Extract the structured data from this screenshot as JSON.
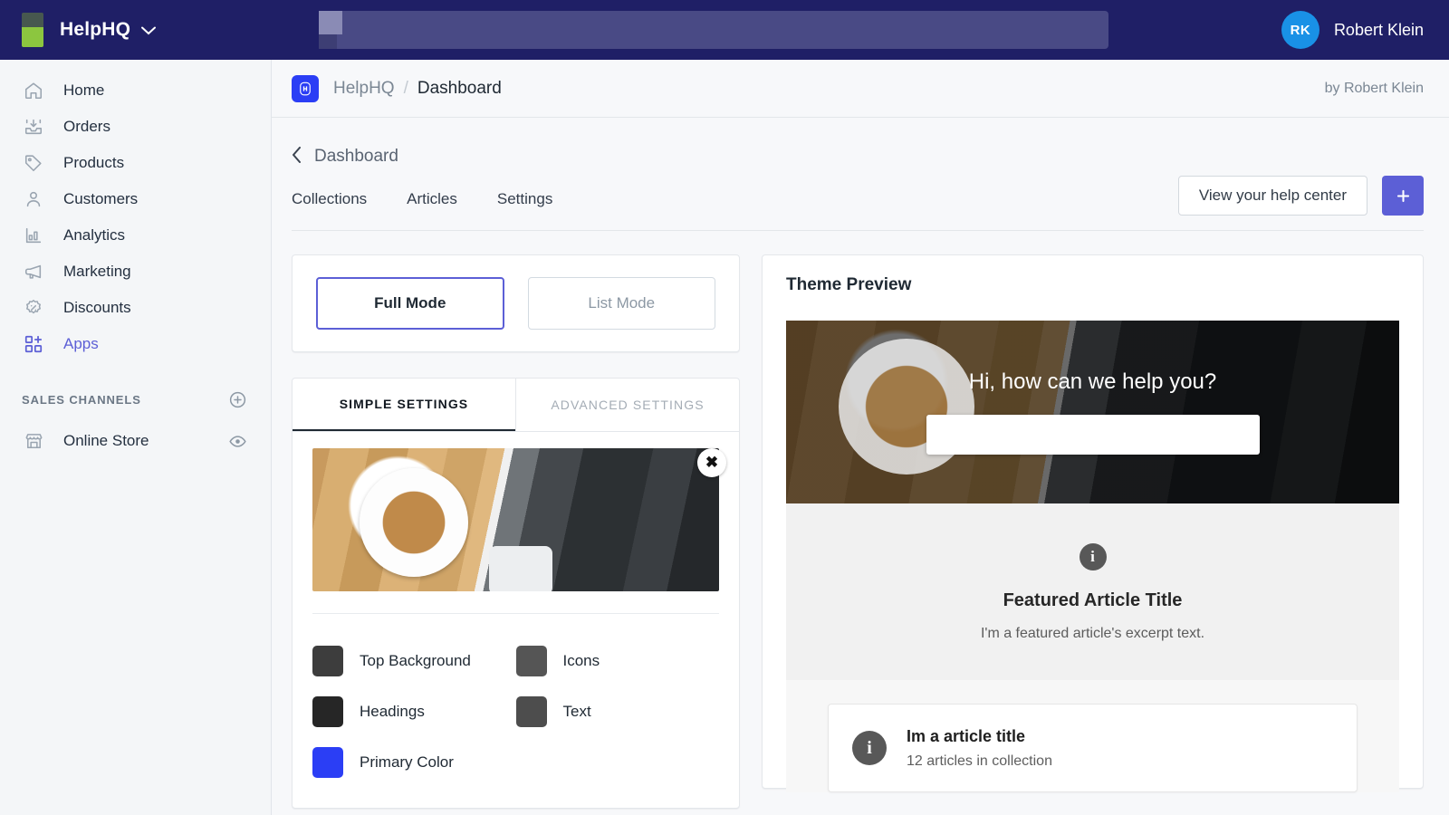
{
  "topbar": {
    "brand_name": "HelpHQ",
    "brand_caret": "⌄",
    "search_value": "",
    "search_placeholder": "",
    "user_initials": "RK",
    "user_name": "Robert Klein"
  },
  "sidebar": {
    "items": [
      {
        "label": "Home",
        "icon": "home-icon",
        "active": false
      },
      {
        "label": "Orders",
        "icon": "orders-icon",
        "active": false
      },
      {
        "label": "Products",
        "icon": "products-tag-icon",
        "active": false
      },
      {
        "label": "Customers",
        "icon": "customers-person-icon",
        "active": false
      },
      {
        "label": "Analytics",
        "icon": "analytics-bar-chart-icon",
        "active": false
      },
      {
        "label": "Marketing",
        "icon": "marketing-megaphone-icon",
        "active": false
      },
      {
        "label": "Discounts",
        "icon": "discounts-percent-icon",
        "active": false
      },
      {
        "label": "Apps",
        "icon": "apps-grid-plus-icon",
        "active": true
      }
    ],
    "section": {
      "title": "SALES CHANNELS",
      "add_icon": "plus-circle-icon"
    },
    "channels": [
      {
        "label": "Online Store",
        "icon": "storefront-icon",
        "action_icon": "eye-icon"
      }
    ]
  },
  "breadcrumb": {
    "app_badge_letter": "H",
    "app_name": "HelpHQ",
    "separator": "/",
    "current": "Dashboard",
    "author": "by Robert Klein"
  },
  "page": {
    "back_label": "Dashboard",
    "back_chevron": "‹",
    "tabs": [
      {
        "label": "Collections"
      },
      {
        "label": "Articles"
      },
      {
        "label": "Settings"
      }
    ],
    "help_center_button": "View your help center",
    "add_button": "+"
  },
  "mode_selector": {
    "options": [
      {
        "label": "Full Mode",
        "selected": true
      },
      {
        "label": "List Mode",
        "selected": false
      }
    ]
  },
  "settings": {
    "tabs": [
      {
        "label": "SIMPLE SETTINGS",
        "active": true
      },
      {
        "label": "ADVANCED SETTINGS",
        "active": false
      }
    ],
    "image_close_icon": "✖",
    "colors": [
      {
        "label": "Top Background",
        "value": "#3d3d3d"
      },
      {
        "label": "Icons",
        "value": "#555555"
      },
      {
        "label": "Headings",
        "value": "#262626"
      },
      {
        "label": "Text",
        "value": "#4d4d4d"
      },
      {
        "label": "Primary Color",
        "value": "#2b3ef5"
      }
    ]
  },
  "preview": {
    "title": "Theme Preview",
    "hero_heading": "Hi, how can we help you?",
    "hero_search_value": "",
    "hero_search_placeholder": "",
    "featured": {
      "icon_glyph": "i",
      "title": "Featured Article Title",
      "excerpt": "I'm a featured article's excerpt text."
    },
    "collection": {
      "icon_glyph": "i",
      "title": "Im a article title",
      "subtitle": "12 articles in collection"
    }
  },
  "theme": {
    "topbar_bg": "#1f1f66",
    "accent": "#5c5fd6",
    "badge_blue": "#2b3ef5",
    "avatar_blue": "#1991e6",
    "logo_green": "#8cc63f"
  }
}
